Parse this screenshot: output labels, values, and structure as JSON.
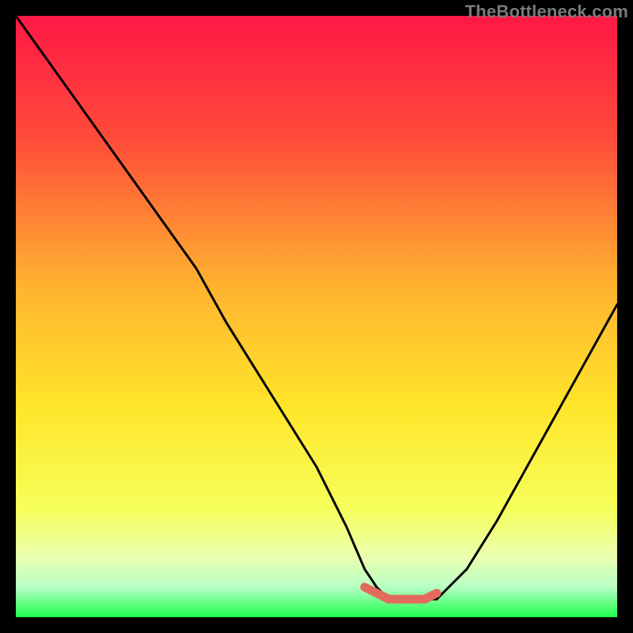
{
  "watermark": "TheBottleneck.com",
  "chart_data": {
    "type": "line",
    "title": "",
    "xlabel": "",
    "ylabel": "",
    "xlim": [
      0,
      100
    ],
    "ylim": [
      0,
      100
    ],
    "gradient_stops": [
      {
        "offset": 0,
        "color": "#ff1846"
      },
      {
        "offset": 0.2,
        "color": "#ff4a3a"
      },
      {
        "offset": 0.45,
        "color": "#ffb330"
      },
      {
        "offset": 0.65,
        "color": "#ffe52a"
      },
      {
        "offset": 0.82,
        "color": "#f6ff5a"
      },
      {
        "offset": 0.9,
        "color": "#eaffb0"
      },
      {
        "offset": 0.95,
        "color": "#b7ffc4"
      },
      {
        "offset": 1.0,
        "color": "#1dff4b"
      }
    ],
    "series": [
      {
        "name": "bottleneck-curve",
        "color": "#000000",
        "x": [
          0,
          5,
          10,
          15,
          20,
          25,
          30,
          35,
          40,
          45,
          50,
          55,
          58,
          60,
          62,
          65,
          68,
          70,
          72,
          75,
          80,
          85,
          90,
          95,
          100
        ],
        "values": [
          100,
          93,
          86,
          79,
          72,
          65,
          58,
          49,
          41,
          33,
          25,
          15,
          8,
          5,
          3,
          3,
          3,
          3,
          5,
          8,
          16,
          25,
          34,
          43,
          52
        ]
      },
      {
        "name": "optimal-region-marker",
        "color": "#e26b5d",
        "x": [
          58,
          60,
          62,
          65,
          68,
          70
        ],
        "values": [
          5,
          4,
          3,
          3,
          3,
          4
        ]
      }
    ]
  }
}
